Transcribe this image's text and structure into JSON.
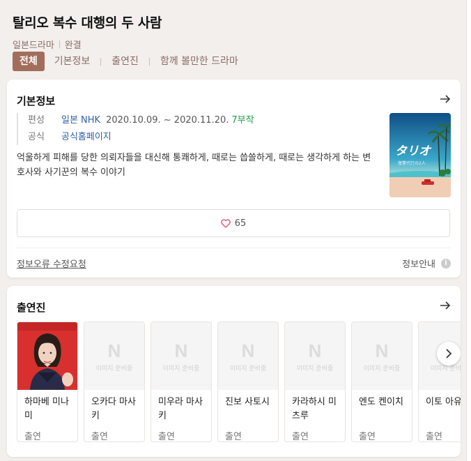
{
  "header": {
    "title": "탈리오 복수 대행의 두 사람",
    "genre": "일본드라마",
    "status": "완결"
  },
  "tabs": [
    {
      "label": "전체",
      "active": true
    },
    {
      "label": "기본정보",
      "active": false
    },
    {
      "label": "출연진",
      "active": false
    },
    {
      "label": "함께 볼만한 드라마",
      "active": false
    }
  ],
  "basic_info": {
    "section_title": "기본정보",
    "broadcast_label": "편성",
    "broadcast_channel": "일본 NHK",
    "broadcast_dates": "2020.10.09. ~ 2020.11.20.",
    "episodes": "7부작",
    "official_label": "공식",
    "official_link": "공식홈페이지",
    "synopsis": "억울하게 피해를 당한 의뢰자들을 대신해 통쾌하게, 때로는 씁쓸하게, 때로는 생각하게 하는 변호사와 사기꾼의 복수 이야기",
    "poster_title": "タリオ",
    "poster_subtitle": "復讐代行の2人",
    "like_count": "65",
    "report_link": "정보오류 수정요청",
    "info_guide": "정보안내",
    "info_guide_icon": "i"
  },
  "cast": {
    "section_title": "출연진",
    "placeholder_letter": "N",
    "placeholder_text": "이미지 준비중",
    "members": [
      {
        "name": "하마베 미나미",
        "role": "출연",
        "has_photo": true
      },
      {
        "name": "오카다 마사키",
        "role": "출연",
        "has_photo": false
      },
      {
        "name": "미우라 마사키",
        "role": "출연",
        "has_photo": false
      },
      {
        "name": "진보 사토시",
        "role": "출연",
        "has_photo": false
      },
      {
        "name": "카라하시 미츠루",
        "role": "출연",
        "has_photo": false
      },
      {
        "name": "엔도 켄이치",
        "role": "출연",
        "has_photo": false
      },
      {
        "name": "이토 아유미",
        "role": "출연",
        "has_photo": false
      }
    ]
  },
  "colors": {
    "accent": "#a16e5c",
    "link": "#2f5fa8",
    "green": "#1f9d4a"
  }
}
